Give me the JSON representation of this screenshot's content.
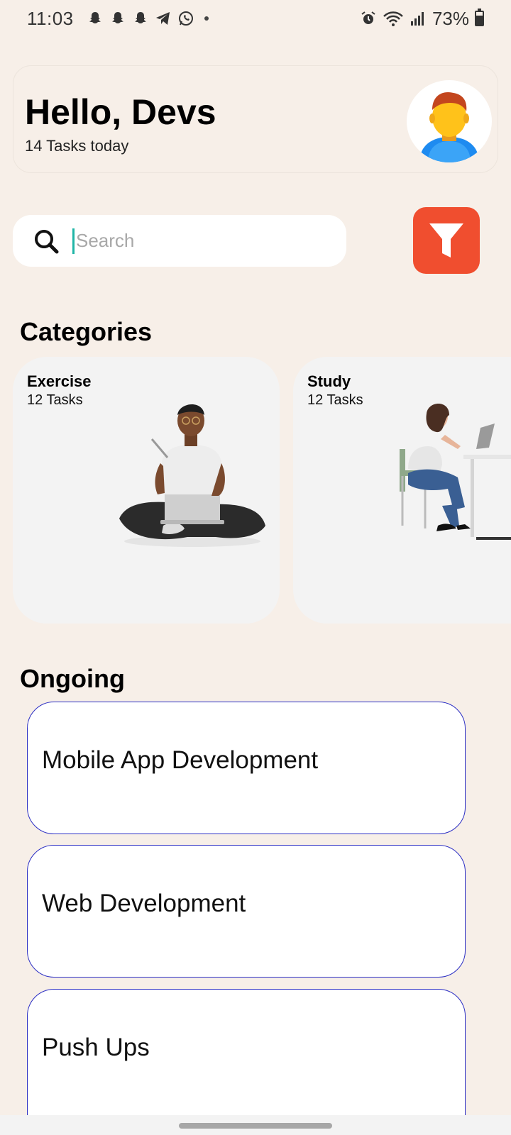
{
  "status": {
    "time": "11:03",
    "battery": "73%"
  },
  "header": {
    "greeting": "Hello, Devs",
    "subtitle": "14 Tasks today"
  },
  "search": {
    "placeholder": "Search",
    "value": ""
  },
  "categories": {
    "title": "Categories",
    "items": [
      {
        "name": "Exercise",
        "count": "12 Tasks"
      },
      {
        "name": "Study",
        "count": "12 Tasks"
      }
    ]
  },
  "ongoing": {
    "title": "Ongoing",
    "items": [
      {
        "title": "Mobile App Development"
      },
      {
        "title": "Web Development"
      },
      {
        "title": "Push Ups"
      }
    ]
  },
  "colors": {
    "background": "#F7EFE8",
    "accent": "#F04E2F",
    "card_border": "#2B2EC4",
    "caret": "#1FB5A6"
  },
  "icons": {
    "status": [
      "snapchat-icon",
      "snapchat-icon",
      "snapchat-icon",
      "telegram-icon",
      "whatsapp-icon",
      "alarm-icon",
      "wifi-icon",
      "signal-icon",
      "battery-icon"
    ],
    "search": "search-icon",
    "filter": "filter-icon",
    "avatar": "user-avatar-icon"
  }
}
